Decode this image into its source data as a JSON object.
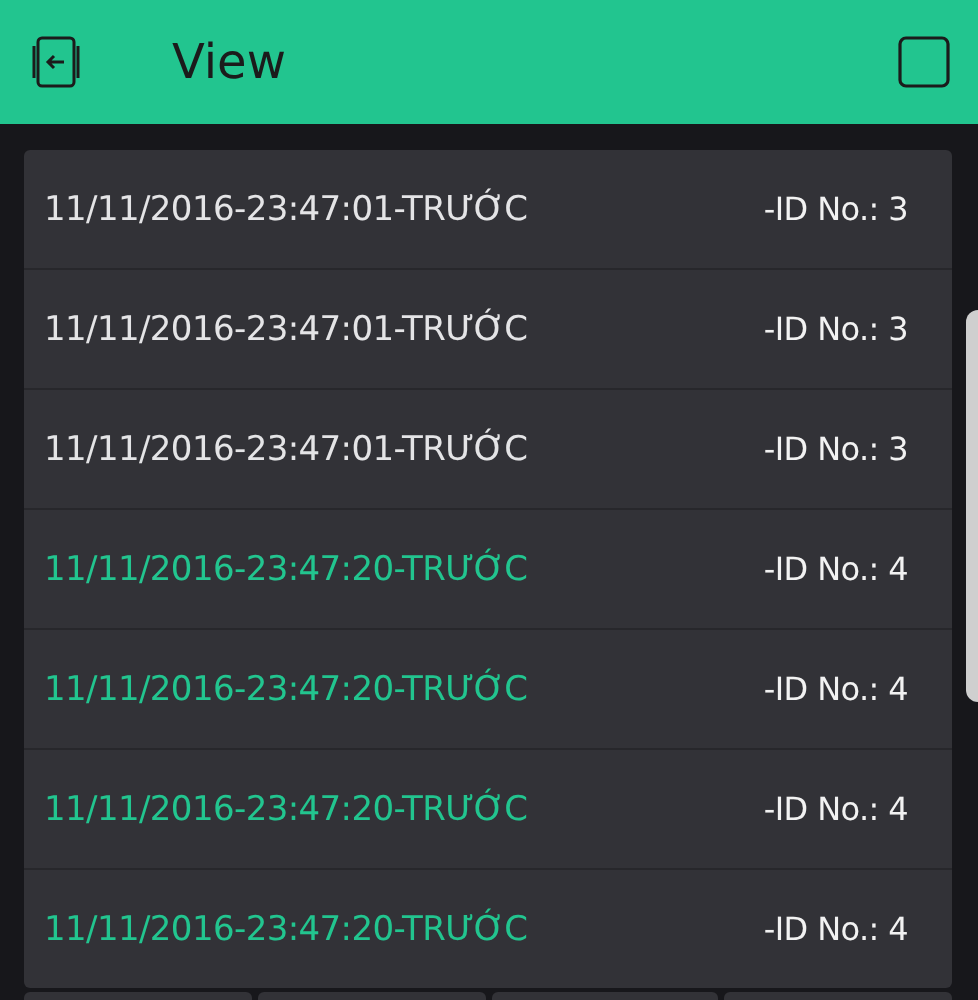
{
  "header": {
    "title": "View"
  },
  "rows": [
    {
      "text": "11/11/2016-23:47:01-TRƯỚC",
      "id": "-ID No.: 3",
      "color": "#e4e4e6"
    },
    {
      "text": "11/11/2016-23:47:01-TRƯỚC",
      "id": "-ID No.: 3",
      "color": "#e4e4e6"
    },
    {
      "text": "11/11/2016-23:47:01-TRƯỚC",
      "id": "-ID No.: 3",
      "color": "#e4e4e6"
    },
    {
      "text": "11/11/2016-23:47:20-TRƯỚC",
      "id": "-ID No.: 4",
      "color": "#22c58f"
    },
    {
      "text": "11/11/2016-23:47:20-TRƯỚC",
      "id": "-ID No.: 4",
      "color": "#22c58f"
    },
    {
      "text": "11/11/2016-23:47:20-TRƯỚC",
      "id": "-ID No.: 4",
      "color": "#22c58f"
    },
    {
      "text": "11/11/2016-23:47:20-TRƯỚC",
      "id": "-ID No.: 4",
      "color": "#22c58f"
    }
  ]
}
